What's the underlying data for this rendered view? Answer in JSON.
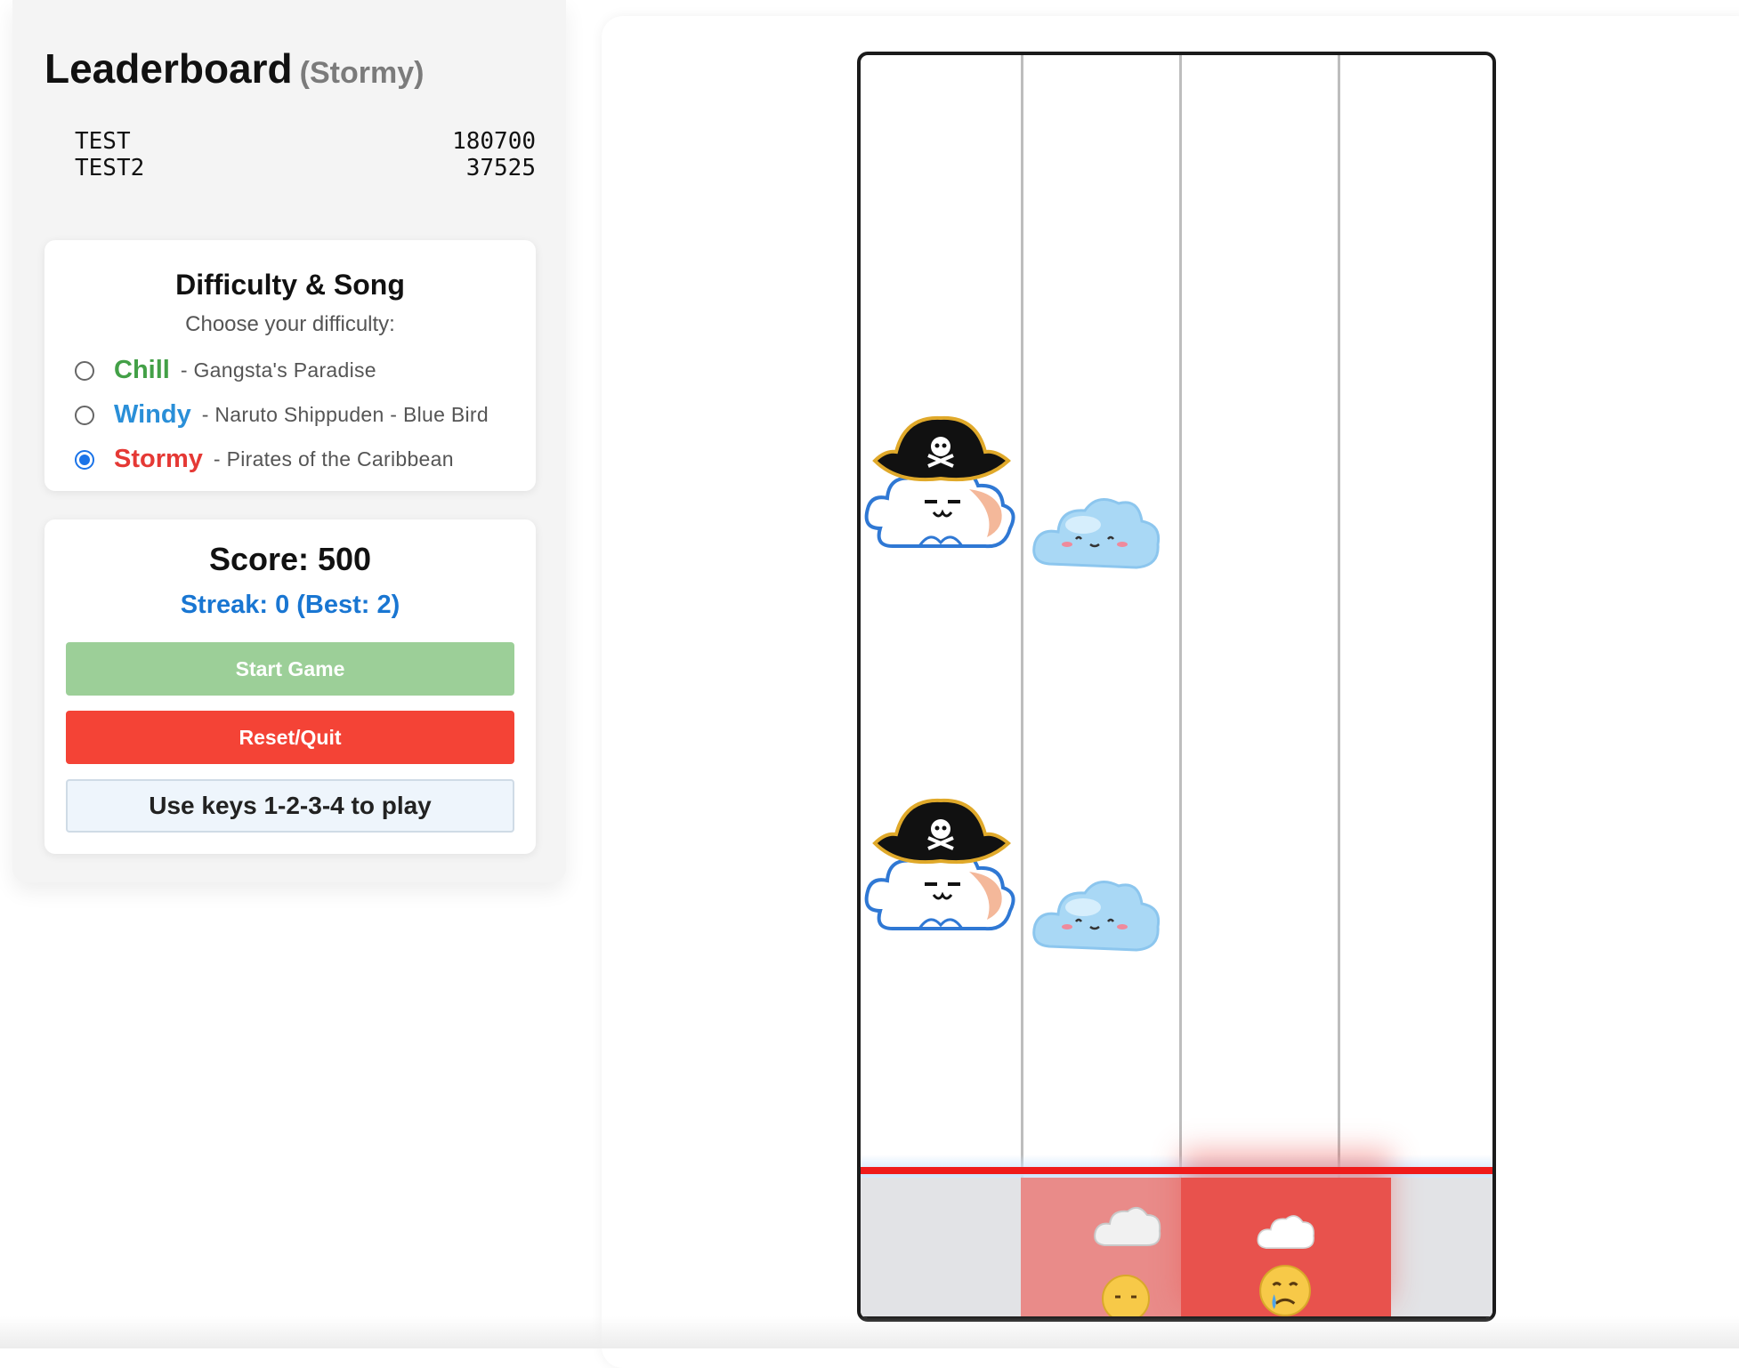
{
  "leaderboard": {
    "title": "Leaderboard",
    "difficulty_label": "(Stormy)",
    "entries": [
      {
        "name": "TEST",
        "score": "180700"
      },
      {
        "name": "TEST2",
        "score": "37525"
      }
    ]
  },
  "difficulty": {
    "title": "Difficulty & Song",
    "subtitle": "Choose your difficulty:",
    "options": [
      {
        "name": "Chill",
        "song": "- Gangsta's Paradise",
        "color": "#43a047",
        "selected": false
      },
      {
        "name": "Windy",
        "song": "- Naruto Shippuden - Blue Bird",
        "color": "#2a8fd8",
        "selected": false
      },
      {
        "name": "Stormy",
        "song": "- Pirates of the Caribbean",
        "color": "#e53935",
        "selected": true
      }
    ]
  },
  "game": {
    "score_text": "Score: 500",
    "streak_text": "Streak: 0 (Best: 2)",
    "start_label": "Start Game",
    "reset_label": "Reset/Quit",
    "keys_hint": "Use keys 1-2-3-4 to play"
  },
  "board": {
    "lanes": 4,
    "notes": [
      {
        "lane": 1,
        "icon": "pirate-cloud-icon"
      },
      {
        "lane": 2,
        "icon": "cute-cloud-icon"
      },
      {
        "lane": 1,
        "icon": "pirate-cloud-icon"
      },
      {
        "lane": 2,
        "icon": "cute-cloud-icon"
      }
    ],
    "missed_lanes": [
      2,
      3
    ],
    "colors": {
      "hit_line": "#ef1b1b",
      "miss_flash": "#e8524d"
    }
  }
}
